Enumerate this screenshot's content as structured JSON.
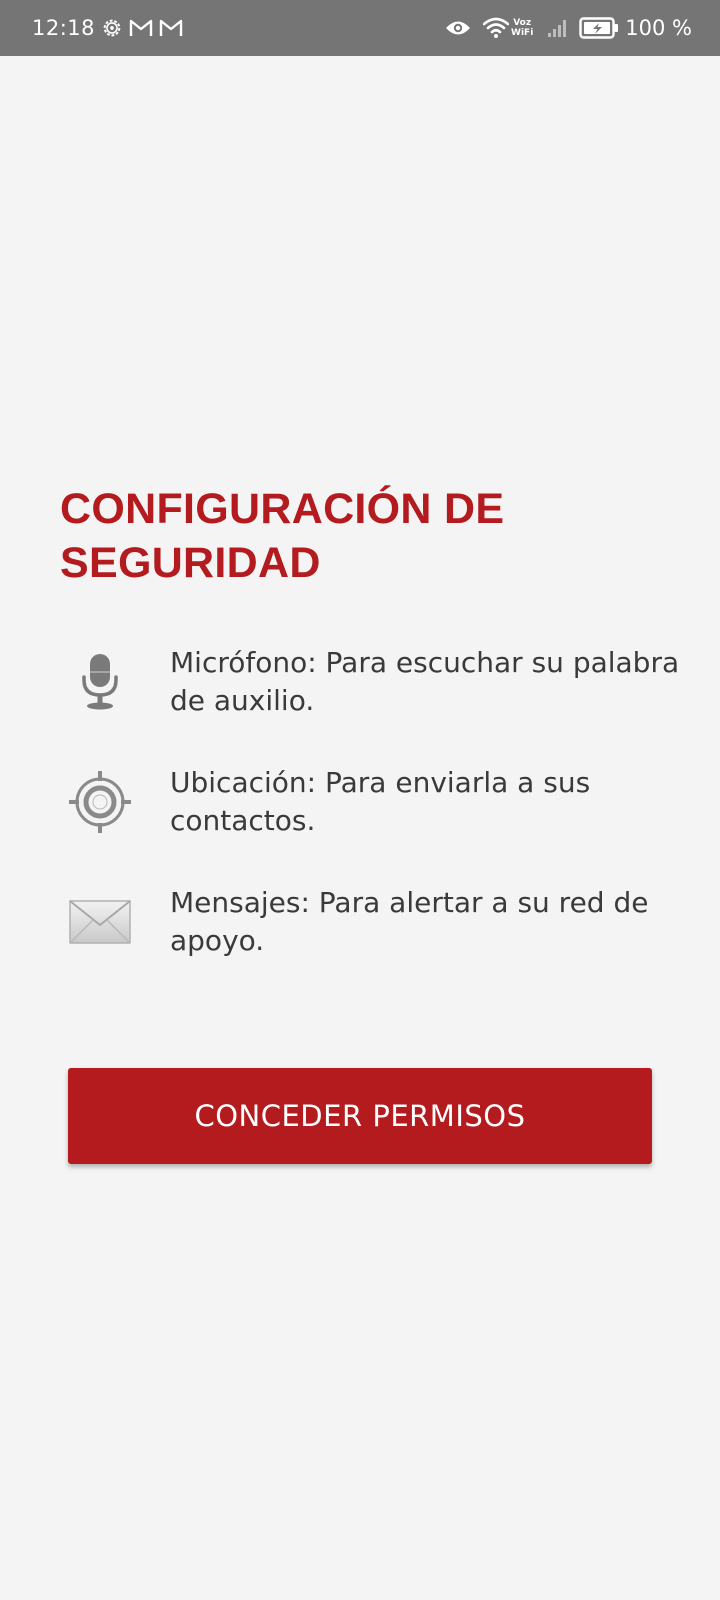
{
  "status_bar": {
    "time": "12:18",
    "left_icons": [
      "settings-gear-icon",
      "gmail-icon",
      "gmail-icon"
    ],
    "right_icons": [
      "eye-icon",
      "wifi-icon",
      "cell-signal-icon",
      "battery-charging-icon"
    ],
    "voz_label": "Voz",
    "wifi_label": "WiFi",
    "battery_text": "100 %",
    "background_color": "#757575"
  },
  "main": {
    "title": "CONFIGURACIÓN DE SEGURIDAD",
    "title_color": "#b31b1f",
    "permissions": [
      {
        "icon": "microphone-icon",
        "text": "Micrófono: Para escuchar su palabra de auxilio."
      },
      {
        "icon": "location-target-icon",
        "text": "Ubicación: Para enviarla a sus contactos."
      },
      {
        "icon": "envelope-icon",
        "text": "Mensajes: Para alertar a su red de apoyo."
      }
    ],
    "grant_button_label": "CONCEDER PERMISOS",
    "button_color": "#b31b1f",
    "background_color": "#f4f4f4"
  }
}
